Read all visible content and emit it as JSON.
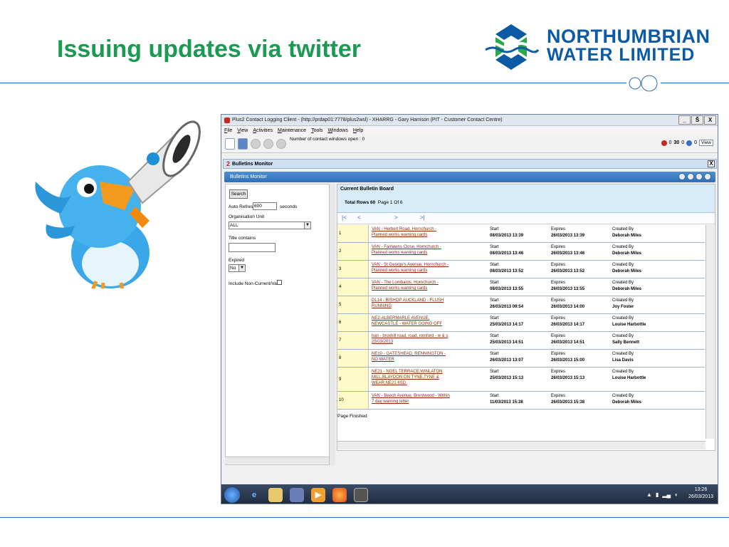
{
  "slide": {
    "title": "Issuing updates via twitter",
    "brand_line1": "NORTHUMBRIAN",
    "brand_line2": "WATER LIMITED"
  },
  "colors": {
    "title_green": "#1a9a52",
    "brand_blue": "#0b5aa6",
    "brand_green": "#2aa84a",
    "row_link": "#8a2a0a",
    "index_yellow": "#fffac8"
  },
  "app": {
    "window_title": "Plus2 Contact Logging Client - (http://prdap01:7778/plus2wsl) - XHARRG - Gary Harrison (PIT - Customer Contact Centre)",
    "window_buttons": [
      "_",
      "Š",
      "X"
    ],
    "menu": [
      "File",
      "View",
      "Activities",
      "Maintenance",
      "Tools",
      "Windows",
      "Help"
    ],
    "toolbar_text": "Number of contact windows open : 0",
    "toolbar_right": {
      "count1": "0",
      "count2": "30",
      "count3": "0",
      "count4": "0",
      "view_label": "View"
    },
    "subwindow_number": "2",
    "subwindow_title": "Bulletins Monitor",
    "subwindow_close": "X",
    "monitor_title": "Bulletins Monitor",
    "filter": {
      "search_label": "Search",
      "auto_refresh_label": "Auto Refresh",
      "auto_refresh_value": "600",
      "seconds_label": "seconds",
      "org_unit_label": "Organisation Unit",
      "org_unit_value": "ALL",
      "title_contains_label": "Title contains",
      "title_contains_value": "",
      "expired_label": "Expired",
      "expired_value": "No",
      "include_label": "Include Non-Current/Valid"
    },
    "board": {
      "title": "Current Bulletin Board",
      "total_label": "Total Rows 60",
      "page_label": "Page 1 Of 6",
      "pager_icons": [
        "|<",
        "<",
        ">",
        ">|"
      ],
      "start_label": "Start",
      "expires_label": "Expires",
      "created_label": "Created By",
      "rows": [
        {
          "idx": "1",
          "title": "VAN - Herbert Road, Hornchurch - Planned works warning cards",
          "start": "08/03/2013 13:39",
          "expires": "26/03/2013 13:39",
          "created": "Deborah Miles"
        },
        {
          "idx": "2",
          "title": "VAN - Fairlawns Close, Hornchurch - Planned works warning cards",
          "start": "08/03/2013 13:46",
          "expires": "26/03/2013 13:46",
          "created": "Deborah Miles"
        },
        {
          "idx": "3",
          "title": "VAN - St George's Avenue, Hornchurch - Planned works warning cards",
          "start": "08/03/2013 13:52",
          "expires": "26/03/2013 13:52",
          "created": "Deborah Miles"
        },
        {
          "idx": "4",
          "title": "VAN - The Lombards, Hornchurch - Planned works warning cards",
          "start": "08/03/2013 13:55",
          "expires": "26/03/2013 13:55",
          "created": "Deborah Miles"
        },
        {
          "idx": "5",
          "title": "DL14 - BISHOP AUCKLAND - FLUSH RUNNING",
          "start": "26/03/2013 09:54",
          "expires": "26/03/2013 14:00",
          "created": "Joy Foster"
        },
        {
          "idx": "6",
          "title": "NE2-ALBERMARLE AVENUE, NEWCASTLE - WATER GOING OFF",
          "start": "25/03/2013 14:17",
          "expires": "26/03/2013 14:17",
          "created": "Louise Harbottle"
        },
        {
          "idx": "7",
          "title": "han - broxhill road, road, romford - w & s 25/03/2013",
          "start": "25/03/2013 14:51",
          "expires": "26/03/2013 14:51",
          "created": "Sally Bennett"
        },
        {
          "idx": "8",
          "title": "NE10 - GATESHEAD, RENNINGTON - NO WATER",
          "start": "26/03/2013 13:07",
          "expires": "26/03/2013 15:00",
          "created": "Lisa Davis"
        },
        {
          "idx": "9",
          "title": "NE21 - NOEL TERRACE,WINLATON MILL,BLAYDON ON TYNE,TYNE & WEAR,NE21 6SD.",
          "start": "25/03/2013 15:13",
          "expires": "26/03/2013 15:13",
          "created": "Louise Harbottle"
        },
        {
          "idx": "10",
          "title": "VAN - Beech Avenue, Brentwood - Within 7 day warning letter",
          "start": "11/03/2013 15:38",
          "expires": "26/03/2013 15:38",
          "created": "Deborah Miles"
        }
      ],
      "page_finished": "Page Finished"
    },
    "taskbar": {
      "time": "13:26",
      "date": "26/03/2013",
      "icons": [
        "start-icon",
        "ie-icon",
        "folder-icon",
        "pen-icon",
        "media-icon",
        "firefox-icon",
        "app-icon"
      ]
    }
  }
}
